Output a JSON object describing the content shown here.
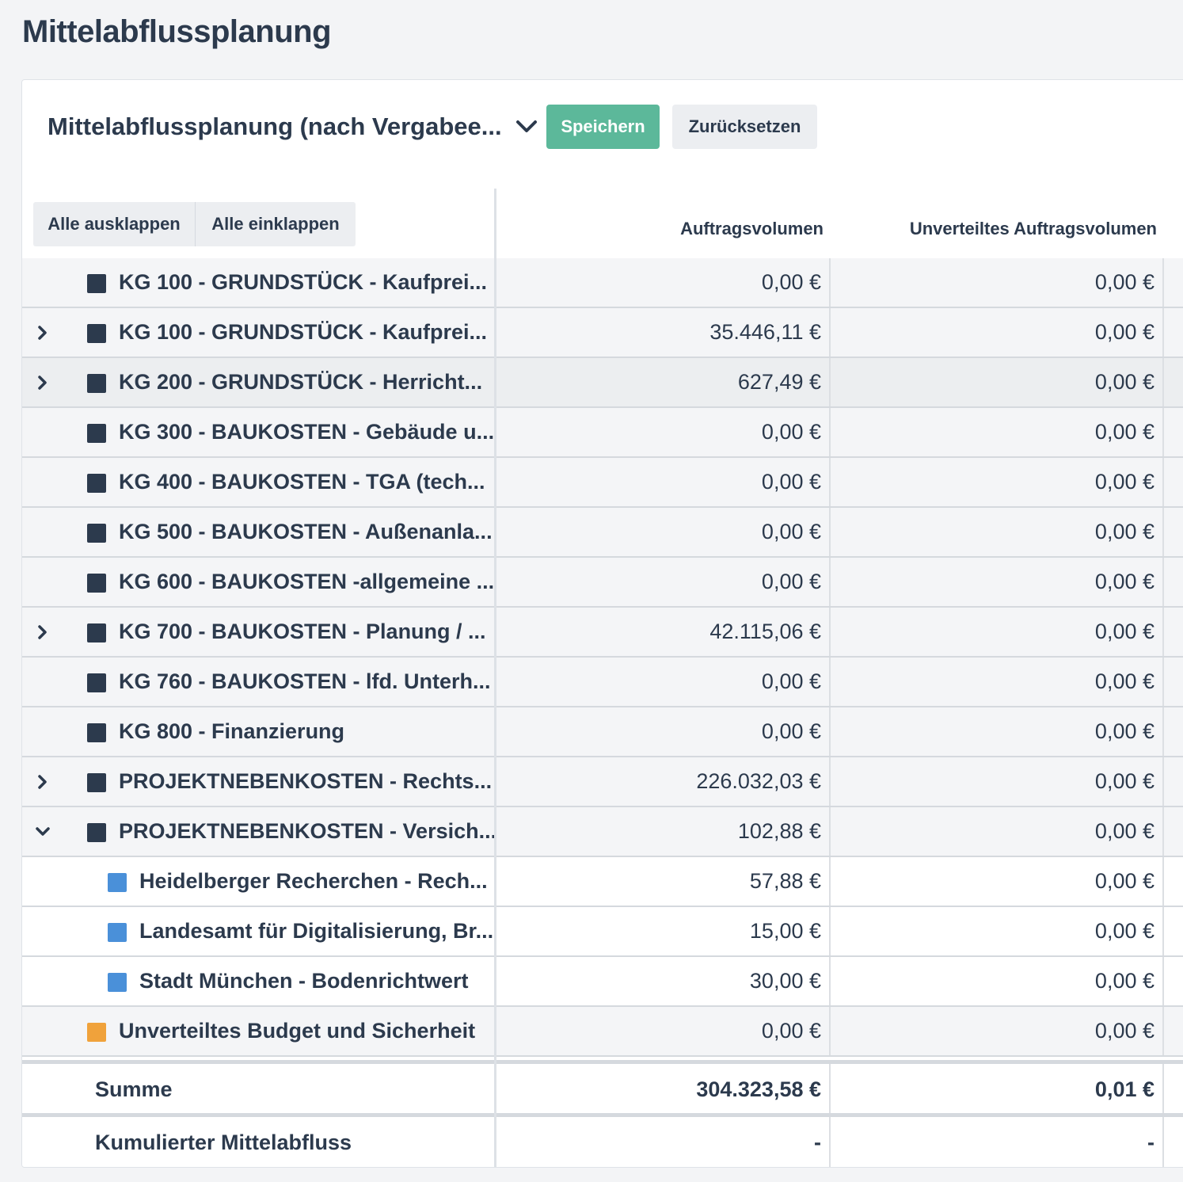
{
  "page": {
    "title": "Mittelabflussplanung"
  },
  "toolbar": {
    "plan_select_value": "Mittelabflussplanung (nach Vergabee...",
    "save_label": "Speichern",
    "reset_label": "Zurücksetzen",
    "save_color": "#5cb89a"
  },
  "tree_controls": {
    "expand_all": "Alle ausklappen",
    "collapse_all": "Alle einklappen"
  },
  "columns": {
    "auftragsvolumen": "Auftragsvolumen",
    "unverteilt": "Unverteiltes Auftragsvolumen"
  },
  "colors": {
    "group_square": "#2c3a4d",
    "child_square": "#4a90d9",
    "budget_square": "#f0a23b"
  },
  "rows": [
    {
      "name": "KG 100 - GRUNDSTÜCK - Kaufprei...",
      "auftrag": "0,00 €",
      "unverteilt": "0,00 €",
      "toggle": "none",
      "level": 0,
      "kind": "group"
    },
    {
      "name": "KG 100 - GRUNDSTÜCK - Kaufprei...",
      "auftrag": "35.446,11 €",
      "unverteilt": "0,00 €",
      "toggle": "collapsed",
      "level": 0,
      "kind": "group"
    },
    {
      "name": "KG 200 - GRUNDSTÜCK - Herricht...",
      "auftrag": "627,49 €",
      "unverteilt": "0,00 €",
      "toggle": "collapsed",
      "level": 0,
      "kind": "group",
      "hover": true
    },
    {
      "name": "KG 300 - BAUKOSTEN - Gebäude u...",
      "auftrag": "0,00 €",
      "unverteilt": "0,00 €",
      "toggle": "none",
      "level": 0,
      "kind": "group"
    },
    {
      "name": "KG 400 - BAUKOSTEN - TGA (tech...",
      "auftrag": "0,00 €",
      "unverteilt": "0,00 €",
      "toggle": "none",
      "level": 0,
      "kind": "group"
    },
    {
      "name": "KG 500 - BAUKOSTEN - Außenanla...",
      "auftrag": "0,00 €",
      "unverteilt": "0,00 €",
      "toggle": "none",
      "level": 0,
      "kind": "group"
    },
    {
      "name": "KG 600 - BAUKOSTEN -allgemeine ...",
      "auftrag": "0,00 €",
      "unverteilt": "0,00 €",
      "toggle": "none",
      "level": 0,
      "kind": "group"
    },
    {
      "name": "KG 700 - BAUKOSTEN - Planung / ...",
      "auftrag": "42.115,06 €",
      "unverteilt": "0,00 €",
      "toggle": "collapsed",
      "level": 0,
      "kind": "group"
    },
    {
      "name": "KG 760 - BAUKOSTEN - lfd. Unterh...",
      "auftrag": "0,00 €",
      "unverteilt": "0,00 €",
      "toggle": "none",
      "level": 0,
      "kind": "group"
    },
    {
      "name": "KG 800 - Finanzierung",
      "auftrag": "0,00 €",
      "unverteilt": "0,00 €",
      "toggle": "none",
      "level": 0,
      "kind": "group"
    },
    {
      "name": "PROJEKTNEBENKOSTEN - Rechts...",
      "auftrag": "226.032,03 €",
      "unverteilt": "0,00 €",
      "toggle": "collapsed",
      "level": 0,
      "kind": "group"
    },
    {
      "name": "PROJEKTNEBENKOSTEN - Versich...",
      "auftrag": "102,88 €",
      "unverteilt": "0,00 €",
      "toggle": "expanded",
      "level": 0,
      "kind": "group"
    },
    {
      "name": "Heidelberger Recherchen - Rech...",
      "auftrag": "57,88 €",
      "unverteilt": "0,00 €",
      "toggle": "none",
      "level": 1,
      "kind": "child"
    },
    {
      "name": "Landesamt für Digitalisierung, Br...",
      "auftrag": "15,00 €",
      "unverteilt": "0,00 €",
      "toggle": "none",
      "level": 1,
      "kind": "child"
    },
    {
      "name": "Stadt München - Bodenrichtwert",
      "auftrag": "30,00 €",
      "unverteilt": "0,00 €",
      "toggle": "none",
      "level": 1,
      "kind": "child"
    },
    {
      "name": "Unverteiltes Budget und Sicherheit",
      "auftrag": "0,00 €",
      "unverteilt": "0,00 €",
      "toggle": "none",
      "level": 0,
      "kind": "budget"
    }
  ],
  "summary": {
    "sum_label": "Summe",
    "sum_auftrag": "304.323,58 €",
    "sum_unverteilt": "0,01 €",
    "cum_label": "Kumulierter Mittelabfluss",
    "cum_auftrag": "-",
    "cum_unverteilt": "-"
  }
}
